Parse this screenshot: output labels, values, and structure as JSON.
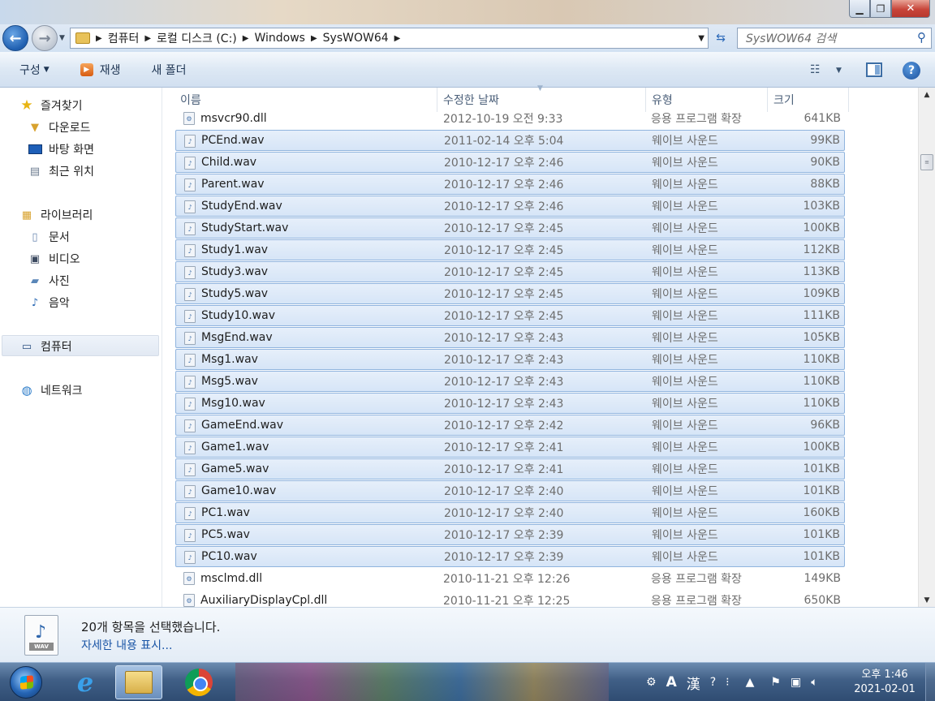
{
  "window": {
    "minimize_glyph": "▁",
    "maximize_glyph": "❐",
    "close_glyph": "✕"
  },
  "address": {
    "back_glyph": "←",
    "forward_glyph": "→",
    "crumbs": [
      "컴퓨터",
      "로컬 디스크 (C:)",
      "Windows",
      "SysWOW64"
    ],
    "search_placeholder": "SysWOW64 검색"
  },
  "toolbar": {
    "organize_label": "구성",
    "play_label": "재생",
    "new_folder_label": "새 폴더"
  },
  "nav": {
    "favorites": {
      "label": "즐겨찾기",
      "icon": "star-icon"
    },
    "favorite_items": [
      {
        "label": "다운로드",
        "icon": "download-folder-icon"
      },
      {
        "label": "바탕 화면",
        "icon": "desktop-icon"
      },
      {
        "label": "최근 위치",
        "icon": "recent-places-icon"
      }
    ],
    "libraries": {
      "label": "라이브러리",
      "icon": "library-icon"
    },
    "library_items": [
      {
        "label": "문서",
        "icon": "documents-icon"
      },
      {
        "label": "비디오",
        "icon": "videos-icon"
      },
      {
        "label": "사진",
        "icon": "pictures-icon"
      },
      {
        "label": "음악",
        "icon": "music-icon"
      }
    ],
    "computer": {
      "label": "컴퓨터",
      "icon": "computer-icon"
    },
    "network": {
      "label": "네트워크",
      "icon": "network-icon"
    }
  },
  "columns": {
    "name": "이름",
    "date": "수정한 날짜",
    "type": "유형",
    "size": "크기"
  },
  "files": [
    {
      "name": "msvcr90.dll",
      "date": "2012-10-19 오전 9:33",
      "type": "응용 프로그램 확장",
      "size": "641KB",
      "selected": false,
      "icon": "dll-icon"
    },
    {
      "name": "PCEnd.wav",
      "date": "2011-02-14 오후 5:04",
      "type": "웨이브 사운드",
      "size": "99KB",
      "selected": true,
      "icon": "wav-icon"
    },
    {
      "name": "Child.wav",
      "date": "2010-12-17 오후 2:46",
      "type": "웨이브 사운드",
      "size": "90KB",
      "selected": true,
      "icon": "wav-icon"
    },
    {
      "name": "Parent.wav",
      "date": "2010-12-17 오후 2:46",
      "type": "웨이브 사운드",
      "size": "88KB",
      "selected": true,
      "icon": "wav-icon"
    },
    {
      "name": "StudyEnd.wav",
      "date": "2010-12-17 오후 2:46",
      "type": "웨이브 사운드",
      "size": "103KB",
      "selected": true,
      "icon": "wav-icon"
    },
    {
      "name": "StudyStart.wav",
      "date": "2010-12-17 오후 2:45",
      "type": "웨이브 사운드",
      "size": "100KB",
      "selected": true,
      "icon": "wav-icon"
    },
    {
      "name": "Study1.wav",
      "date": "2010-12-17 오후 2:45",
      "type": "웨이브 사운드",
      "size": "112KB",
      "selected": true,
      "icon": "wav-icon"
    },
    {
      "name": "Study3.wav",
      "date": "2010-12-17 오후 2:45",
      "type": "웨이브 사운드",
      "size": "113KB",
      "selected": true,
      "icon": "wav-icon"
    },
    {
      "name": "Study5.wav",
      "date": "2010-12-17 오후 2:45",
      "type": "웨이브 사운드",
      "size": "109KB",
      "selected": true,
      "icon": "wav-icon"
    },
    {
      "name": "Study10.wav",
      "date": "2010-12-17 오후 2:45",
      "type": "웨이브 사운드",
      "size": "111KB",
      "selected": true,
      "icon": "wav-icon"
    },
    {
      "name": "MsgEnd.wav",
      "date": "2010-12-17 오후 2:43",
      "type": "웨이브 사운드",
      "size": "105KB",
      "selected": true,
      "icon": "wav-icon"
    },
    {
      "name": "Msg1.wav",
      "date": "2010-12-17 오후 2:43",
      "type": "웨이브 사운드",
      "size": "110KB",
      "selected": true,
      "icon": "wav-icon"
    },
    {
      "name": "Msg5.wav",
      "date": "2010-12-17 오후 2:43",
      "type": "웨이브 사운드",
      "size": "110KB",
      "selected": true,
      "icon": "wav-icon"
    },
    {
      "name": "Msg10.wav",
      "date": "2010-12-17 오후 2:43",
      "type": "웨이브 사운드",
      "size": "110KB",
      "selected": true,
      "icon": "wav-icon"
    },
    {
      "name": "GameEnd.wav",
      "date": "2010-12-17 오후 2:42",
      "type": "웨이브 사운드",
      "size": "96KB",
      "selected": true,
      "icon": "wav-icon"
    },
    {
      "name": "Game1.wav",
      "date": "2010-12-17 오후 2:41",
      "type": "웨이브 사운드",
      "size": "100KB",
      "selected": true,
      "icon": "wav-icon"
    },
    {
      "name": "Game5.wav",
      "date": "2010-12-17 오후 2:41",
      "type": "웨이브 사운드",
      "size": "101KB",
      "selected": true,
      "icon": "wav-icon"
    },
    {
      "name": "Game10.wav",
      "date": "2010-12-17 오후 2:40",
      "type": "웨이브 사운드",
      "size": "101KB",
      "selected": true,
      "icon": "wav-icon"
    },
    {
      "name": "PC1.wav",
      "date": "2010-12-17 오후 2:40",
      "type": "웨이브 사운드",
      "size": "160KB",
      "selected": true,
      "icon": "wav-icon"
    },
    {
      "name": "PC5.wav",
      "date": "2010-12-17 오후 2:39",
      "type": "웨이브 사운드",
      "size": "101KB",
      "selected": true,
      "icon": "wav-icon"
    },
    {
      "name": "PC10.wav",
      "date": "2010-12-17 오후 2:39",
      "type": "웨이브 사운드",
      "size": "101KB",
      "selected": true,
      "icon": "wav-icon"
    },
    {
      "name": "msclmd.dll",
      "date": "2010-11-21 오후 12:26",
      "type": "응용 프로그램 확장",
      "size": "149KB",
      "selected": false,
      "icon": "dll-icon"
    },
    {
      "name": "AuxiliaryDisplayCpl.dll",
      "date": "2010-11-21 오후 12:25",
      "type": "응용 프로그램 확장",
      "size": "650KB",
      "selected": false,
      "icon": "dll-icon"
    }
  ],
  "details": {
    "summary": "20개 항목을 선택했습니다.",
    "show_more": "자세한 내용 표시...",
    "file_badge": "WAV"
  },
  "taskbar": {
    "ime_label": "A",
    "ime_hanja": "漢",
    "clock_time": "오후 1:46",
    "clock_date": "2021-02-01"
  },
  "colors": {
    "selection_fill": "#dde9f8",
    "selection_border": "#90b4de",
    "link": "#1a55a6"
  }
}
